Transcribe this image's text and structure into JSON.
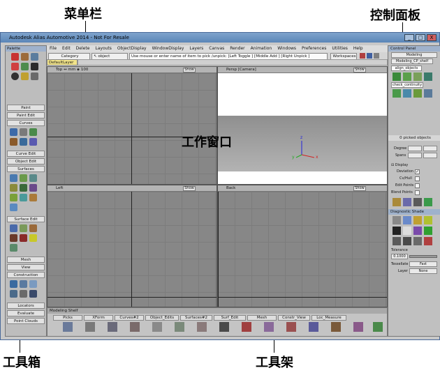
{
  "annotations": {
    "menubar": "菜单栏",
    "control_panel": "控制面板",
    "work_window": "工作窗口",
    "toolbox": "工具箱",
    "shelf": "工具架"
  },
  "window": {
    "title": "Autodesk Alias Automotive 2014 - Not For Resale",
    "minimize": "_",
    "maximize": "□",
    "close": "X"
  },
  "menu": {
    "items": [
      "File",
      "Edit",
      "Delete",
      "Layouts",
      "ObjectDisplay",
      "WindowDisplay",
      "Layers",
      "Canvas",
      "Render",
      "Animation",
      "Windows",
      "Preferences",
      "Utilities",
      "Help"
    ]
  },
  "toolbar": {
    "category": "Category",
    "object": "object",
    "prompt": "Use mouse or enter name of item to pick /unpick: [Left Toggle ] [Middle Add ] [Right Unpick ]",
    "workspaces": "Workspaces",
    "default_layer": "DefaultLayer"
  },
  "palette": {
    "title": "Palette",
    "categories": [
      "Paint",
      "Paint Edit",
      "Curves",
      "Curve Edit",
      "Object Edit",
      "Surfaces",
      "Surface Edit",
      "Mesh",
      "View",
      "Construction",
      "Locators",
      "Evaluate",
      "Point Clouds"
    ]
  },
  "viewports": {
    "top": {
      "label": "Top",
      "units": "mm",
      "zoom": "100",
      "show": "Show"
    },
    "persp": {
      "label": "Persp [Camera]",
      "show": "Show"
    },
    "left": {
      "label": "Left",
      "show": "Show"
    },
    "back": {
      "label": "Back",
      "show": "Show"
    },
    "axis_x": "x",
    "axis_y": "y",
    "axis_z": "z"
  },
  "control_panel": {
    "title": "Control Panel",
    "workspace": "Modeling",
    "shelf": "Modeling_CP_shelf",
    "tab_align": "align_objects",
    "tab_check": "check_continuity",
    "picked": "0 picked objects",
    "degree": "Degree",
    "spans": "Spans",
    "display": "Display",
    "deviation": "Deviation",
    "cvhull": "Cv/Hull",
    "edit_points": "Edit Points",
    "blend_points": "Blend Points",
    "diag_shade": "Diagnostic Shade",
    "tolerance": "Tolerance",
    "tolerance_value": "0.1000",
    "tessellate": "Tessellate",
    "tessellate_value": "Fast",
    "layer": "Layer",
    "layer_value": "None"
  },
  "shelf": {
    "title": "Modeling Shelf",
    "tabs": [
      "Picks",
      "XForm",
      "Curves#2",
      "Object_Edits",
      "Surfaces#2",
      "Surf_Edit",
      "Mesh",
      "Constr_View",
      "Loc_Measure"
    ]
  },
  "colors": {
    "title_bar": "#6a93c2",
    "viewport_bg": "#878787",
    "axis_x": "#d22222",
    "axis_y": "#22aa22",
    "axis_z": "#2222dd"
  }
}
